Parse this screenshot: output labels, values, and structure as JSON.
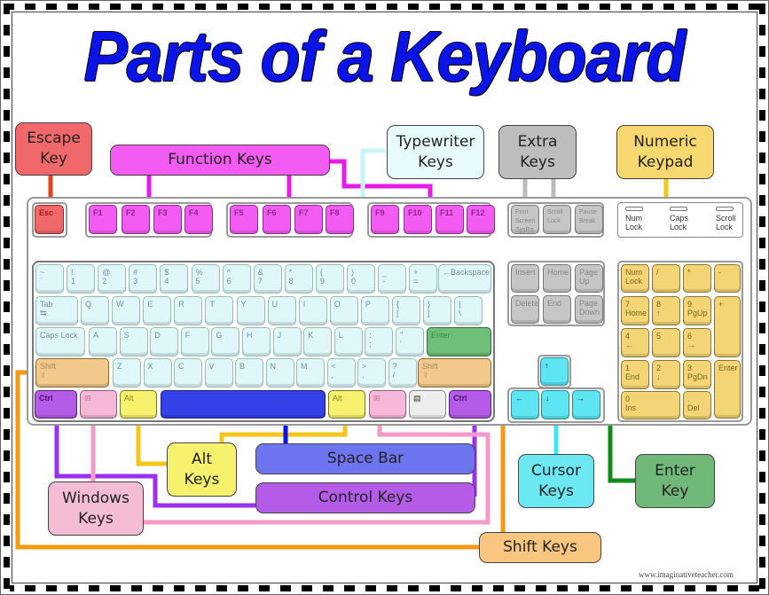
{
  "title": "Parts of a Keyboard",
  "colors": {
    "title": "#0a14e6",
    "escape": "#f0686a",
    "function": "#f25cf2",
    "typewriter": "#dff7f8",
    "extra": "#c6c6c6",
    "numeric": "#f4d576",
    "cursor": "#5de6f2",
    "enter": "#6fbf79",
    "shift": "#f3c88b",
    "control": "#b45ce8",
    "windows": "#f5b8d8",
    "alt": "#f7f26e",
    "space": "#3440e8"
  },
  "labels": {
    "escape": "Escape\nKey",
    "function": "Function Keys",
    "typewriter": "Typewriter\nKeys",
    "extra": "Extra\nKeys",
    "numeric": "Numeric\nKeypad",
    "alt": "Alt\nKeys",
    "space": "Space Bar",
    "control": "Control Keys",
    "windows": "Windows\nKeys",
    "cursor": "Cursor\nKeys",
    "enter": "Enter\nKey",
    "shift": "Shift Keys"
  },
  "keys": {
    "esc": "Esc",
    "fn": [
      "F1",
      "F2",
      "F3",
      "F4",
      "F5",
      "F6",
      "F7",
      "F8",
      "F9",
      "F10",
      "F11",
      "F12"
    ],
    "extra_top": [
      "Print\nScreen\nSysRq",
      "Scroll\nLock",
      "Pause\nBreak"
    ],
    "leds": [
      "Num\nLock",
      "Caps\nLock",
      "Scroll\nLock"
    ],
    "row1": [
      "~\n`",
      "!\n1",
      "@\n2",
      "#\n3",
      "$\n4",
      "%\n5",
      "^\n6",
      "&\n7",
      "*\n8",
      "(\n9",
      ")\n0",
      "_\n-",
      "+\n="
    ],
    "backspace": "←Backspace",
    "tab": "Tab\n⇆",
    "row2": [
      "Q",
      "W",
      "E",
      "R",
      "T",
      "Y",
      "U",
      "I",
      "O",
      "P",
      "{\n[",
      "}\n]",
      "|\n\\"
    ],
    "caps": "Caps Lock",
    "row3": [
      "A",
      "S",
      "D",
      "F",
      "G",
      "H",
      "J",
      "K",
      "L",
      ":\n;",
      "\"\n'"
    ],
    "enter": "Enter",
    "shift": "Shift\n⇧",
    "row4": [
      "Z",
      "X",
      "C",
      "V",
      "B",
      "N",
      "M",
      "<\n,",
      ">\n.",
      "?\n/"
    ],
    "ctrl": "Ctrl",
    "alt": "Alt",
    "win": "⊞",
    "menu": "▤",
    "extra_mid": [
      "Insert",
      "Home",
      "Page\nUp",
      "Delete",
      "End",
      "Page\nDown"
    ],
    "cursor": [
      "↑",
      "←",
      "↓",
      "→"
    ],
    "numpad": [
      "Num\nLock",
      "/",
      "*",
      "-",
      "7\nHome",
      "8\n↑",
      "9\nPgUp",
      "+",
      "4\n←",
      "5",
      "6\n→",
      "1\nEnd",
      "2\n↓",
      "3\nPgDn",
      "Enter",
      "0\nIns",
      ".\nDel"
    ]
  },
  "credit": "www.imaginativeteacher.com"
}
